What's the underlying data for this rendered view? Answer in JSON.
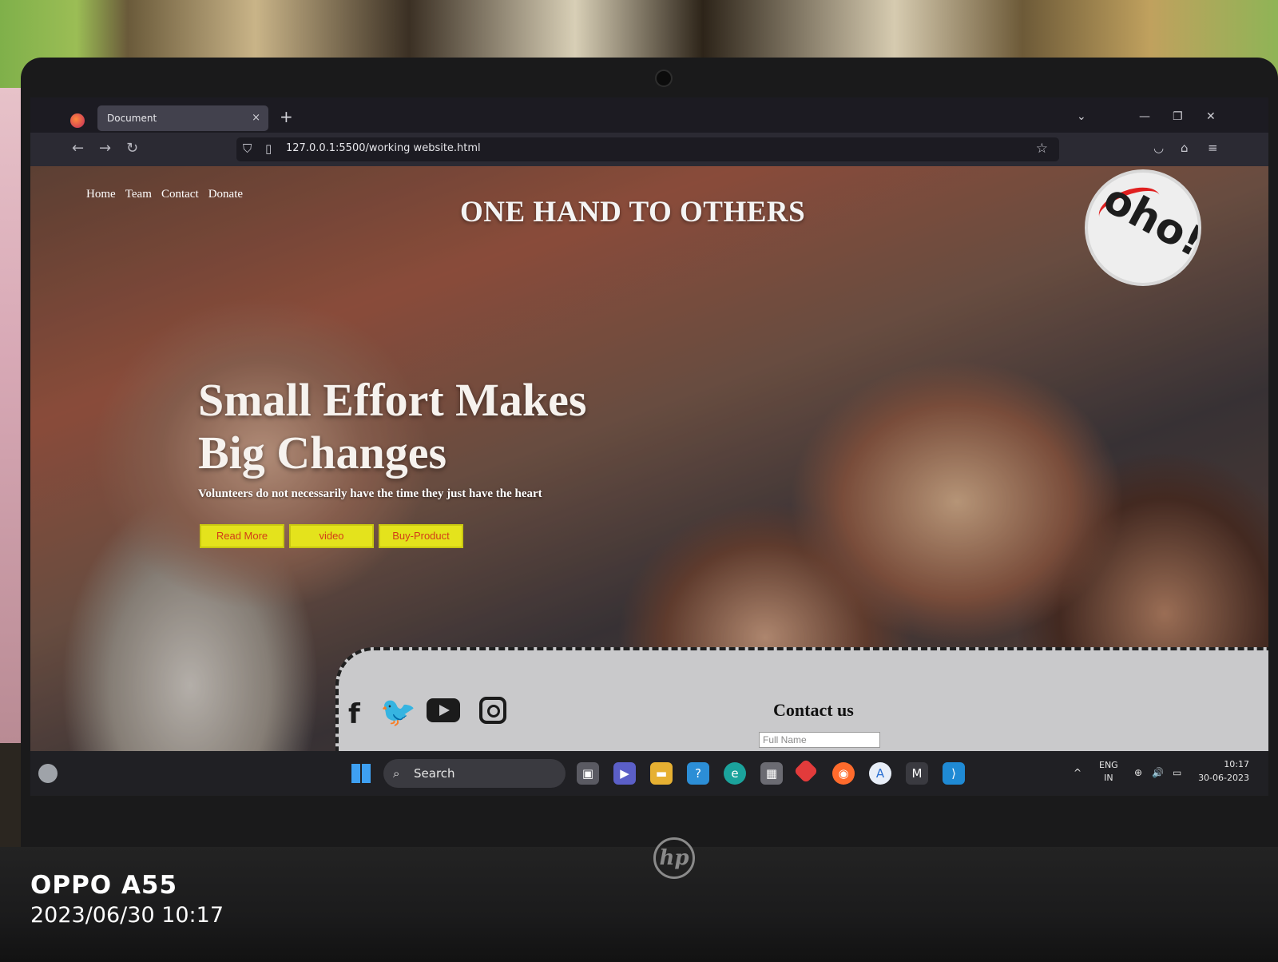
{
  "browser": {
    "tab_title": "Document",
    "tab_close": "×",
    "new_tab": "+",
    "url": "127.0.0.1:5500/working website.html",
    "icons": [
      "firefox-logo",
      "back-arrow",
      "forward-arrow",
      "reload",
      "shield",
      "page",
      "bookmark-star",
      "pocket",
      "extensions",
      "menu"
    ]
  },
  "site": {
    "nav": [
      "Home",
      "Team",
      "Contact",
      "Donate"
    ],
    "title": "ONE HAND TO OTHERS",
    "logo_text": "oho!",
    "hero_line1": "Small Effort Makes",
    "hero_line2": "Big Changes",
    "hero_sub": "Volunteers do not necessarily have the time they just have the heart",
    "buttons": [
      "Read More",
      "video",
      "Buy-Product"
    ],
    "button_color": "#e4e31c",
    "button_text_color": "#d23d18"
  },
  "contact": {
    "title": "Contact us",
    "name_placeholder": "Full Name",
    "social_icons": [
      "facebook-icon",
      "twitter-icon",
      "youtube-icon",
      "instagram-icon"
    ]
  },
  "taskbar": {
    "search_label": "Search",
    "lang_line1": "ENG",
    "lang_line2": "IN",
    "time": "10:17",
    "date": "30-06-2023"
  },
  "photo": {
    "device_brand": "OPPO A55",
    "timestamp": "2023/06/30 10:17",
    "laptop_logo": "hp"
  }
}
